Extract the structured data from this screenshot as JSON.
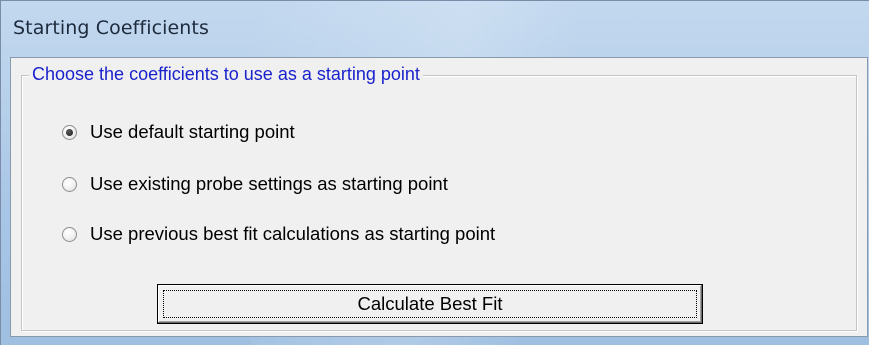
{
  "window": {
    "title": "Starting Coefficients"
  },
  "group": {
    "legend": "Choose the coefficients to use as a starting point",
    "legend_color": "#1a22cc"
  },
  "options": [
    {
      "label": "Use default starting point",
      "checked": true
    },
    {
      "label": "Use existing probe settings as starting point",
      "checked": false
    },
    {
      "label": "Use previous best fit calculations as starting point",
      "checked": false
    }
  ],
  "actions": {
    "calculate_label": "Calculate Best Fit"
  }
}
